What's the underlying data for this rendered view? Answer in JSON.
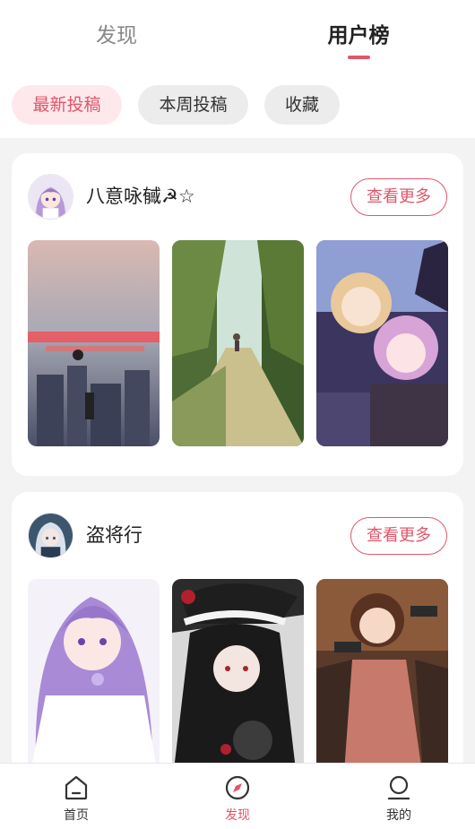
{
  "header": {
    "tabs": [
      {
        "label": "发现",
        "active": false
      },
      {
        "label": "用户榜",
        "active": true
      }
    ]
  },
  "filters": [
    {
      "label": "最新投稿",
      "active": true
    },
    {
      "label": "本周投稿",
      "active": false
    },
    {
      "label": "收藏",
      "active": false
    }
  ],
  "users": [
    {
      "name": "八意咏㦽☭☆",
      "more_label": "查看更多"
    },
    {
      "name": "盗将行",
      "more_label": "查看更多"
    }
  ],
  "bottom_nav": [
    {
      "label": "首页",
      "icon": "home-icon",
      "active": false
    },
    {
      "label": "发现",
      "icon": "compass-icon",
      "active": true
    },
    {
      "label": "我的",
      "icon": "profile-icon",
      "active": false
    }
  ],
  "colors": {
    "accent": "#e0566a",
    "background": "#f3f3f3"
  }
}
